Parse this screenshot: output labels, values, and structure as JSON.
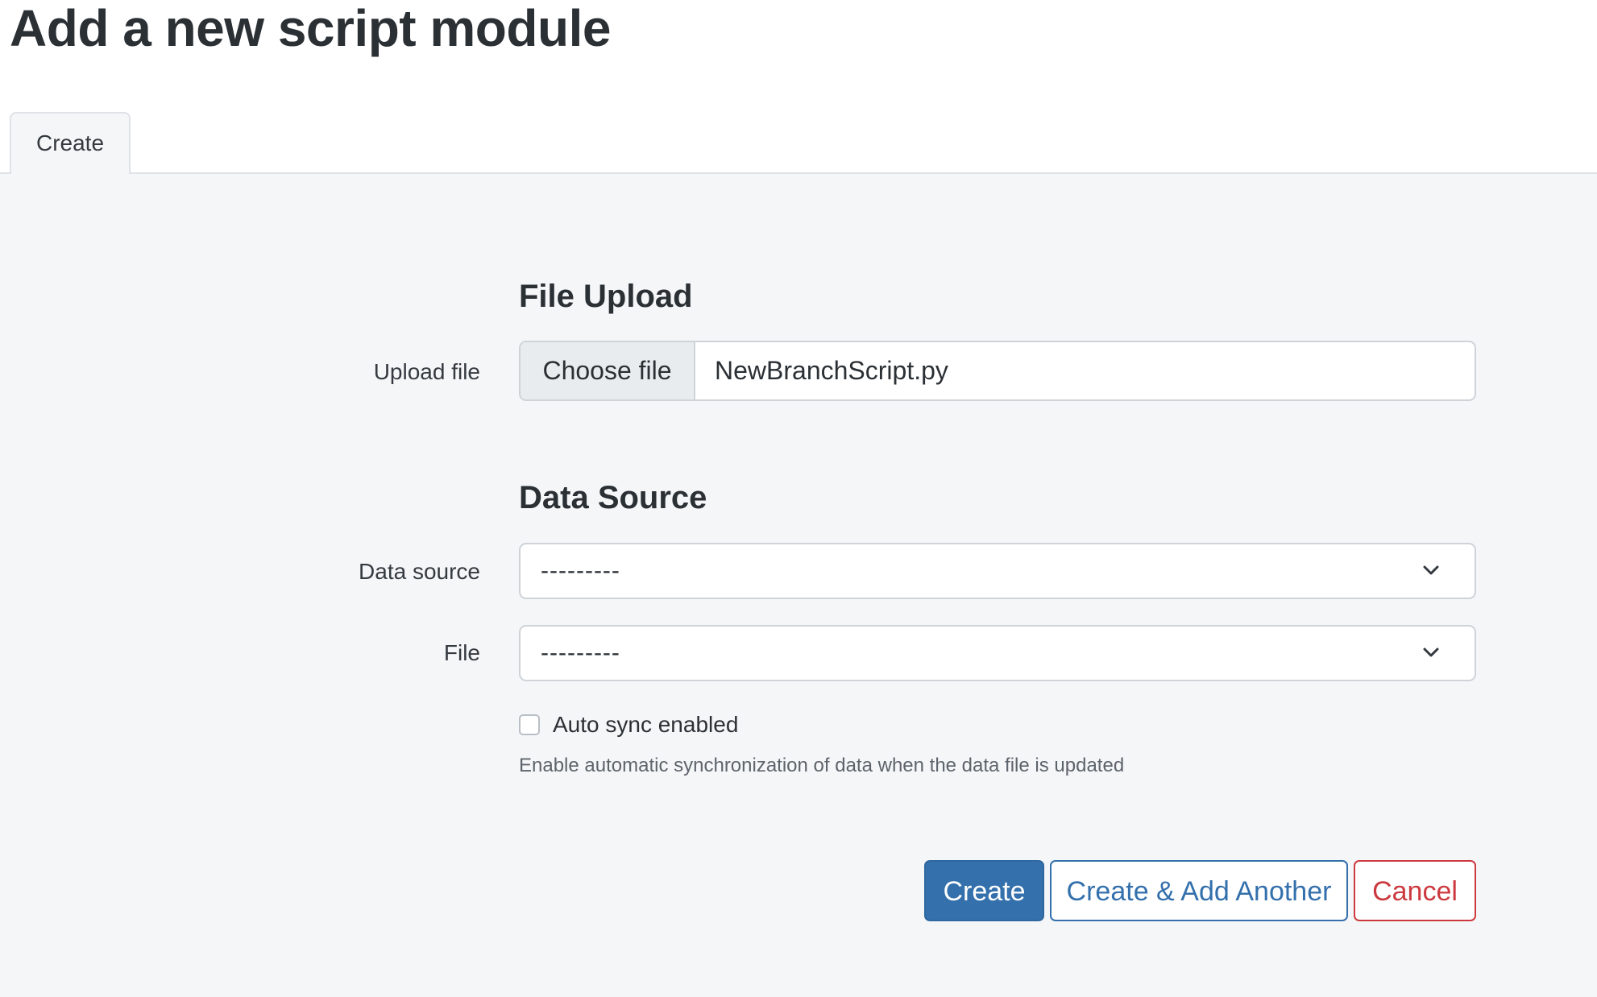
{
  "page": {
    "title": "Add a new script module"
  },
  "tabs": [
    {
      "label": "Create",
      "active": true
    }
  ],
  "file_upload": {
    "heading": "File Upload",
    "label": "Upload file",
    "button_label": "Choose file",
    "file_name": "NewBranchScript.py"
  },
  "data_source_section": {
    "heading": "Data Source",
    "data_source": {
      "label": "Data source",
      "selected": "---------"
    },
    "file": {
      "label": "File",
      "selected": "---------"
    },
    "auto_sync": {
      "label": "Auto sync enabled",
      "checked": false,
      "help_text": "Enable automatic synchronization of data when the data file is updated"
    }
  },
  "actions": {
    "create_label": "Create",
    "create_add_another_label": "Create & Add Another",
    "cancel_label": "Cancel"
  },
  "colors": {
    "primary": "#3370ac",
    "danger": "#cc3a3f",
    "background": "#f5f6f8",
    "header_background": "#ffffff"
  },
  "icons": {
    "select_indicator": "chevron-down-icon"
  }
}
